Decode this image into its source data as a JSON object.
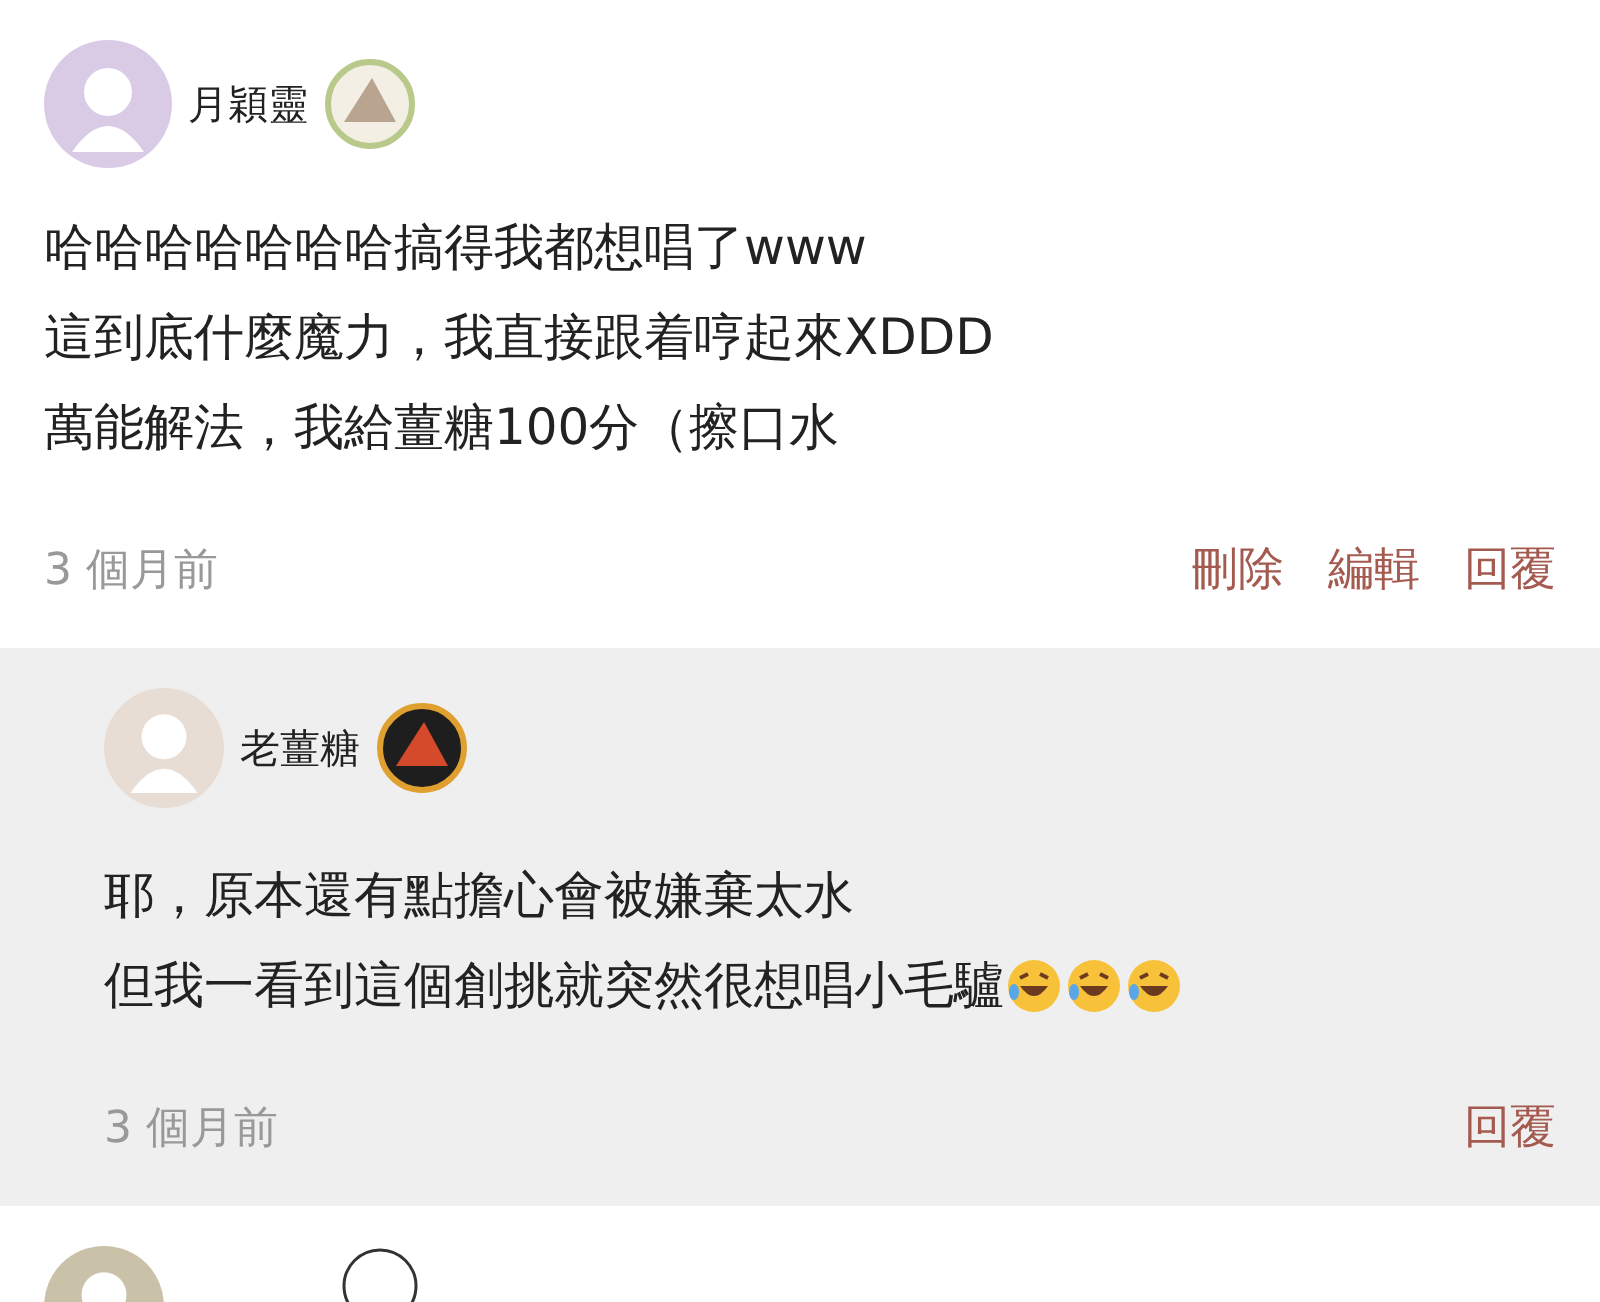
{
  "comments": [
    {
      "author": "月穎靈",
      "lines": [
        "哈哈哈哈哈哈哈搞得我都想唱了www",
        "這到底什麼魔力，我直接跟着哼起來XDDD",
        "萬能解法，我給薑糖100分（擦口水"
      ],
      "time": "3 個月前",
      "actions": [
        "刪除",
        "編輯",
        "回覆"
      ],
      "replies": [
        {
          "author": "老薑糖",
          "lines": [
            "耶，原本還有點擔心會被嫌棄太水",
            "但我一看到這個創挑就突然很想唱小毛驢"
          ],
          "emoji": [
            {
              "kind": "laugh"
            },
            {
              "kind": "laugh"
            },
            {
              "kind": "laugh"
            }
          ],
          "time": "3 個月前",
          "actions": [
            "回覆"
          ]
        }
      ]
    }
  ]
}
